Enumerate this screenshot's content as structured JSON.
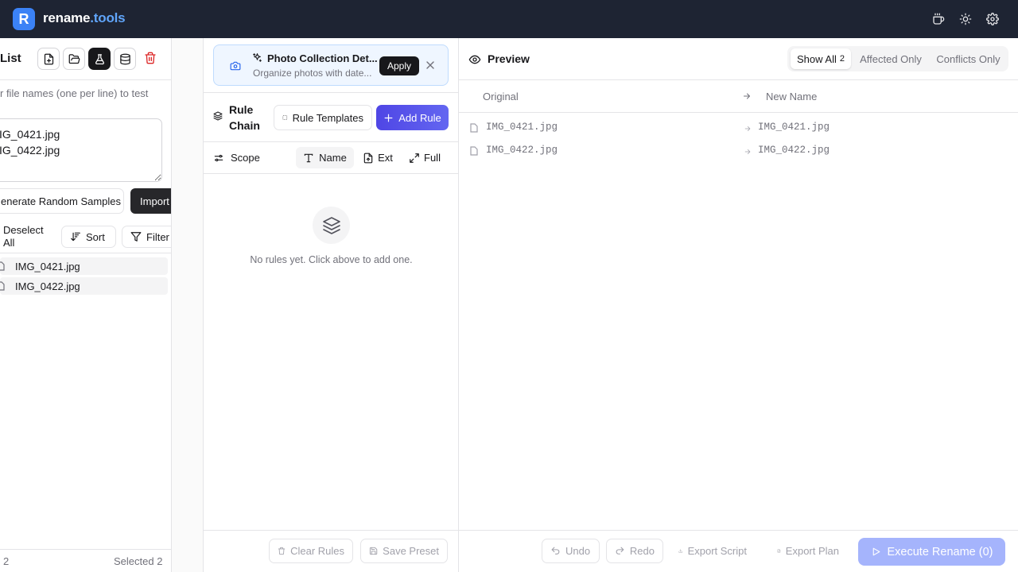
{
  "app": {
    "logo_letter": "R",
    "brand_main": "rename",
    "brand_accent": ".tools"
  },
  "left": {
    "title": "List",
    "hint": "r file names (one per line) to test",
    "textarea_value": "IG_0421.jpg\nIG_0422.jpg",
    "generate_label": "enerate Random Samples",
    "import_label": "Import Files",
    "deselect_label": "Deselect All",
    "sort_label": "Sort",
    "filter_label": "Filter",
    "files": [
      "IMG_0421.jpg",
      "IMG_0422.jpg"
    ],
    "footer_count": "2",
    "footer_selected": "Selected 2"
  },
  "suggestion": {
    "title": "Photo Collection Det...",
    "subtitle": "Organize photos with date...",
    "apply_label": "Apply"
  },
  "rules": {
    "title_line1": "Rule",
    "title_line2": "Chain",
    "templates_label": "Rule Templates",
    "add_label": "Add Rule",
    "scope_label": "Scope",
    "scope_options": [
      "Name",
      "Ext",
      "Full"
    ],
    "empty_text": "No rules yet. Click above to add one.",
    "clear_label": "Clear Rules",
    "save_label": "Save Preset"
  },
  "preview": {
    "title": "Preview",
    "tab_all": "Show All",
    "tab_all_count": "2",
    "tab_affected": "Affected Only",
    "tab_conflicts": "Conflicts Only",
    "col_original": "Original",
    "col_new": "New Name",
    "rows": [
      {
        "original": "IMG_0421.jpg",
        "new": "IMG_0421.jpg"
      },
      {
        "original": "IMG_0422.jpg",
        "new": "IMG_0422.jpg"
      }
    ],
    "undo_label": "Undo",
    "redo_label": "Redo",
    "export_script_label": "Export Script",
    "export_plan_label": "Export Plan",
    "execute_label": "Execute Rename (0)"
  },
  "colors": {
    "topbar": "#1e2433",
    "accent": "#4f46e5",
    "danger": "#dc2626",
    "execute_disabled": "#a5b4fc"
  }
}
